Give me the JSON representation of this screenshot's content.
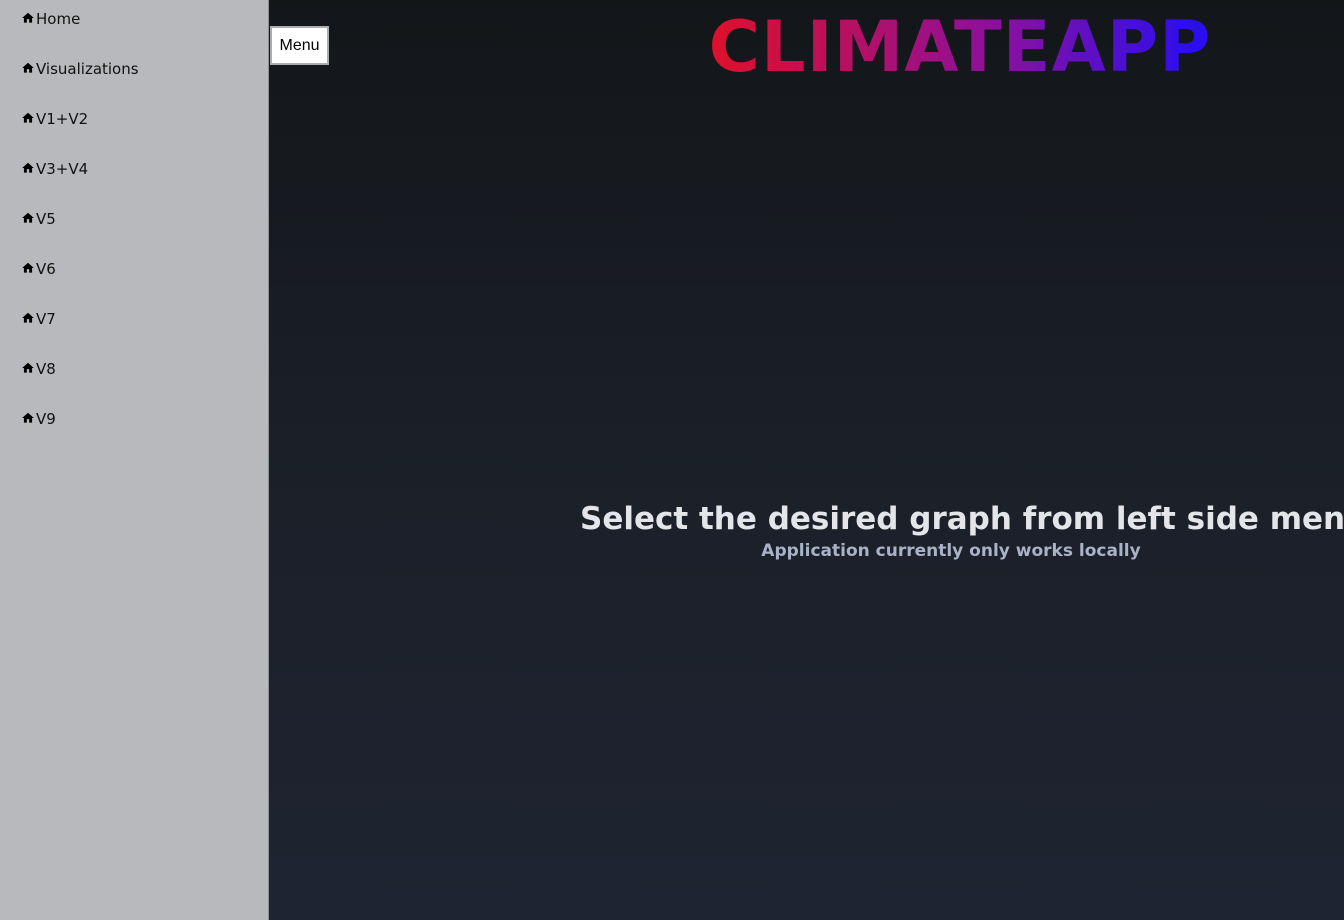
{
  "sidebar": {
    "items": [
      {
        "label": "Home",
        "icon": "home-icon"
      },
      {
        "label": "Visualizations",
        "icon": "home-icon"
      },
      {
        "label": "V1+V2",
        "icon": "home-icon"
      },
      {
        "label": "V3+V4",
        "icon": "home-icon"
      },
      {
        "label": "V5",
        "icon": "home-icon"
      },
      {
        "label": "V6",
        "icon": "home-icon"
      },
      {
        "label": "V7",
        "icon": "home-icon"
      },
      {
        "label": "V8",
        "icon": "home-icon"
      },
      {
        "label": "V9",
        "icon": "home-icon"
      }
    ]
  },
  "header": {
    "menu_label": "Menu",
    "brand_title": "CLIMATEAPP"
  },
  "main": {
    "heading": "Select the desired graph from left side menu",
    "subheading": "Application currently only works locally"
  },
  "colors": {
    "sidebar_bg": "#b8b9bc",
    "page_bg_top": "#131619",
    "page_bg_bottom": "#1f2432",
    "brand_gradient_start": "#e0102a",
    "brand_gradient_mid": "#8a10a0",
    "brand_gradient_end": "#2a0ef0",
    "heading_text": "#e3e5e9",
    "subheading_text": "#a9b2c6"
  }
}
